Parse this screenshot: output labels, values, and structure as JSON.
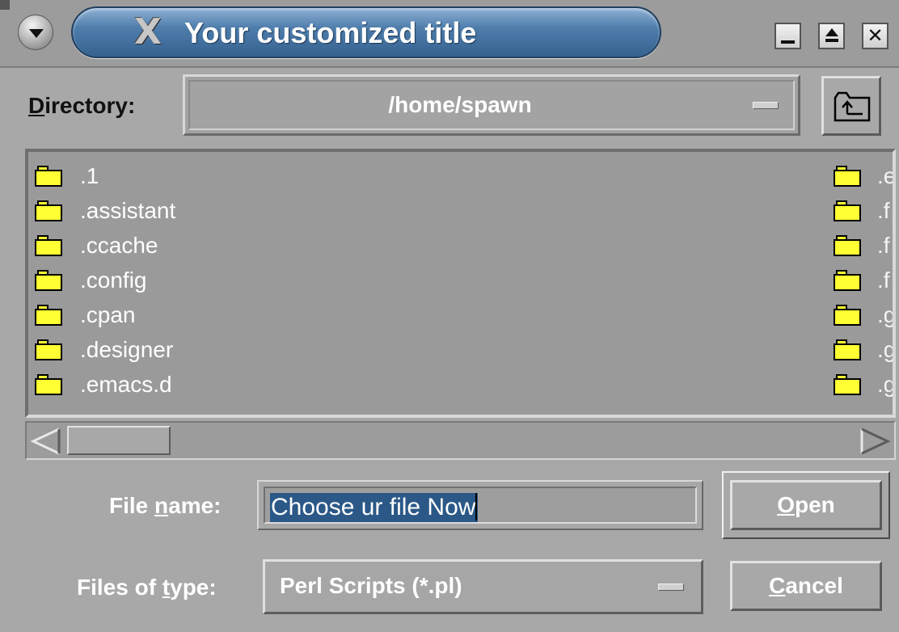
{
  "window": {
    "title": "Your customized title",
    "logo_glyph": "X",
    "buttons": {
      "minimize_icon": "minimize-icon",
      "maximize_icon": "maximize-icon",
      "close_icon": "close-icon"
    }
  },
  "directory": {
    "label_prefix": "D",
    "label_rest": "irectory:",
    "value": "/home/spawn"
  },
  "files_left": [
    {
      "name": ".1"
    },
    {
      "name": ".assistant"
    },
    {
      "name": ".ccache"
    },
    {
      "name": ".config"
    },
    {
      "name": ".cpan"
    },
    {
      "name": ".designer"
    },
    {
      "name": ".emacs.d"
    }
  ],
  "files_right": [
    {
      "name": ".e"
    },
    {
      "name": ".f"
    },
    {
      "name": ".f"
    },
    {
      "name": ".f"
    },
    {
      "name": ".g"
    },
    {
      "name": ".g"
    },
    {
      "name": ".g"
    }
  ],
  "file_name": {
    "label_before": "File ",
    "label_ul": "n",
    "label_after": "ame:",
    "value": "Choose ur file Now"
  },
  "file_type": {
    "label_before": "Files of ",
    "label_ul": "t",
    "label_after": "ype:",
    "value": "Perl Scripts (*.pl)"
  },
  "buttons": {
    "open_ul": "O",
    "open_rest": "pen",
    "cancel_ul": "C",
    "cancel_rest": "ancel"
  },
  "colors": {
    "window_bg": "#a8a8a8",
    "title_blue": "#4f7eac",
    "selection": "#2b5887",
    "folder_yellow": "#ffff33"
  }
}
